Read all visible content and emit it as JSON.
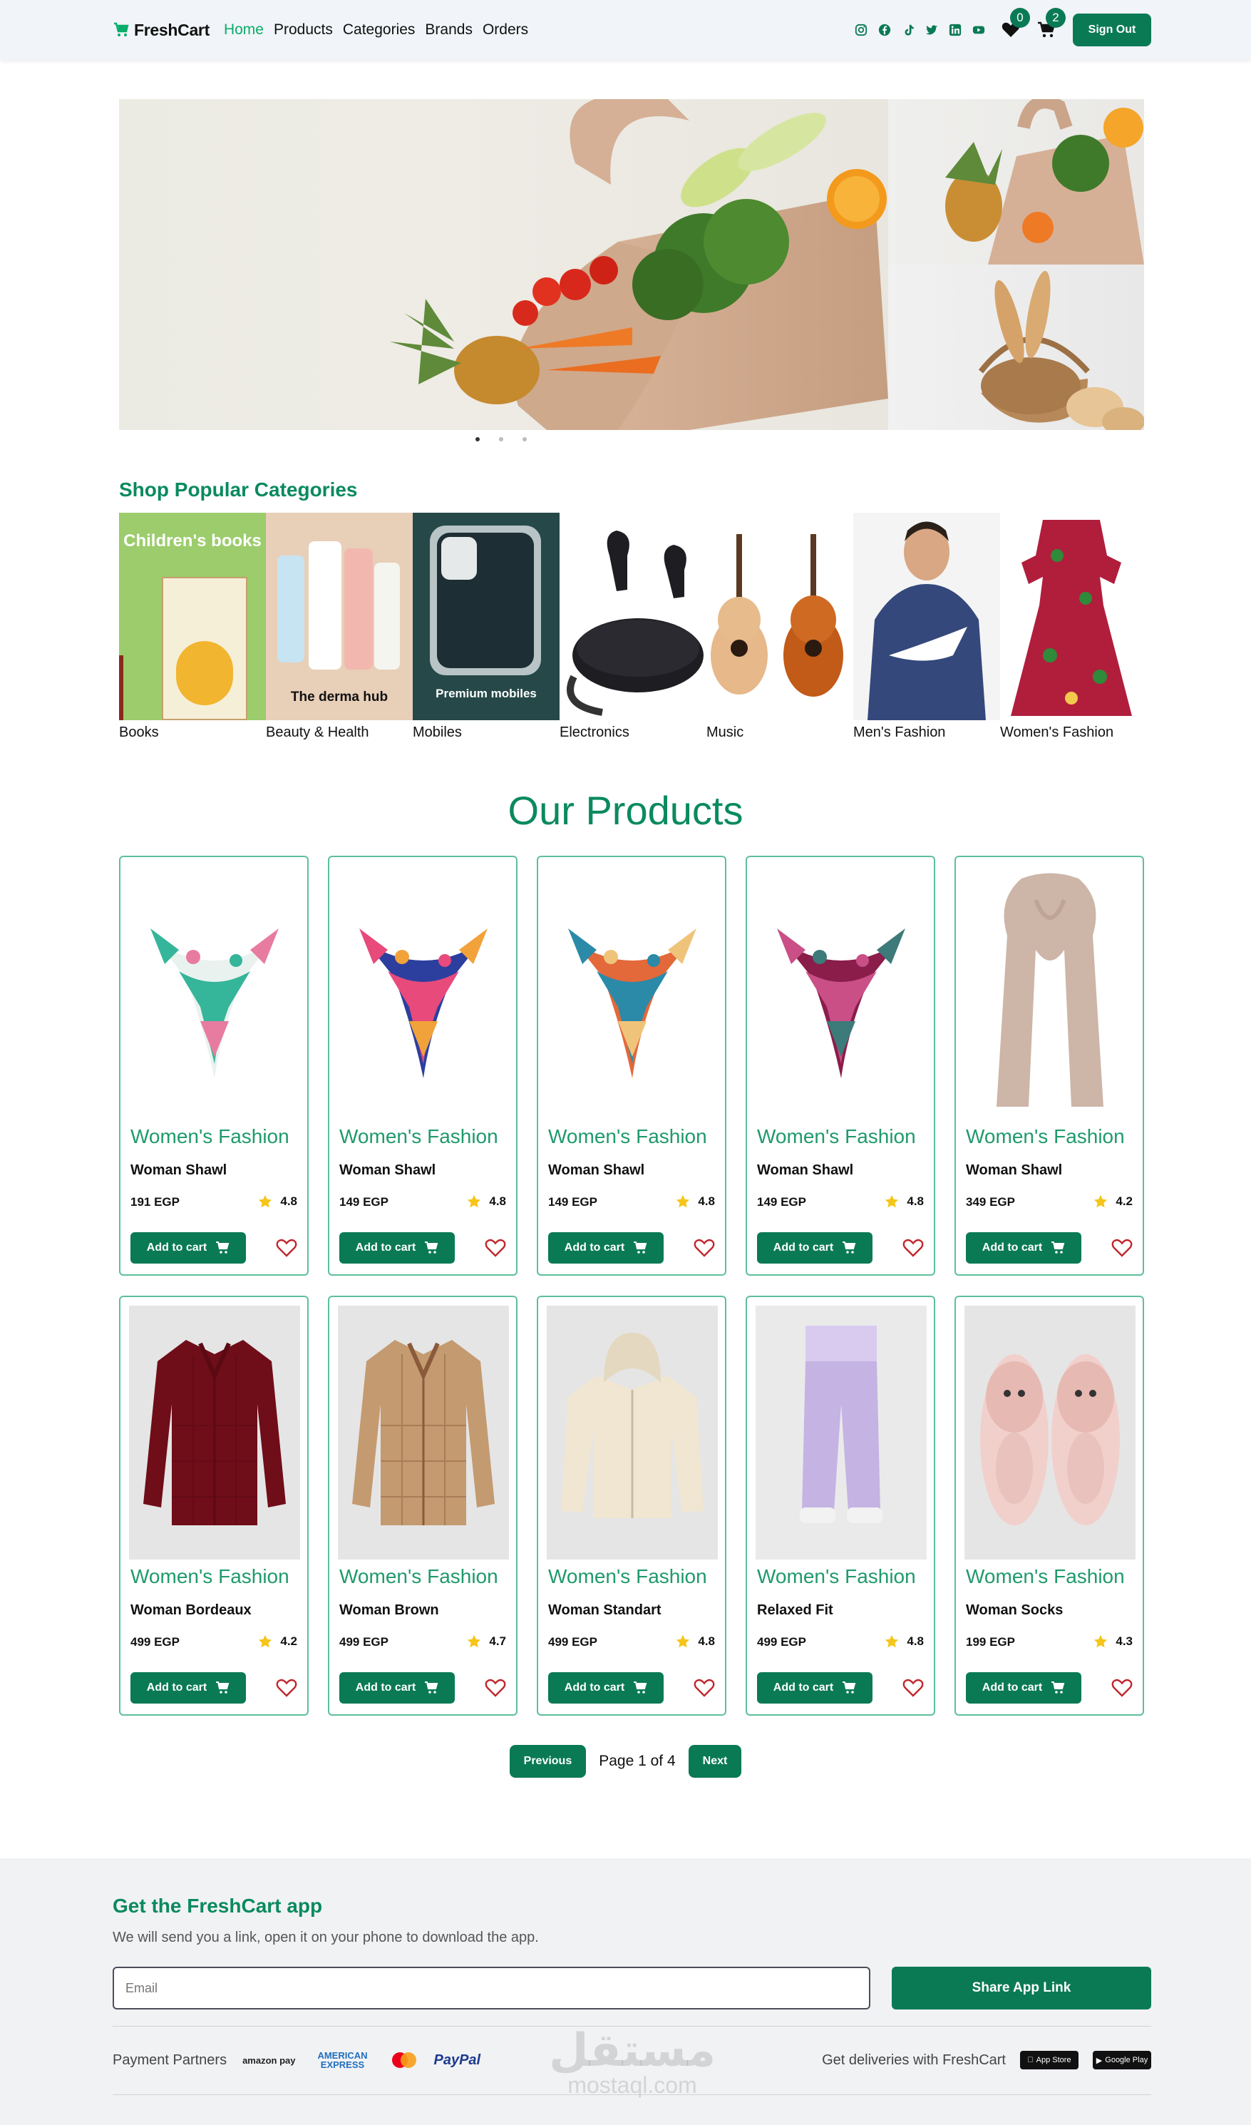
{
  "navbar": {
    "brand": "FreshCart",
    "links": [
      {
        "label": "Home",
        "active": true
      },
      {
        "label": "Products",
        "active": false
      },
      {
        "label": "Categories",
        "active": false
      },
      {
        "label": "Brands",
        "active": false
      },
      {
        "label": "Orders",
        "active": false
      }
    ],
    "socials": [
      "instagram-icon",
      "facebook-icon",
      "tiktok-icon",
      "twitter-icon",
      "linkedin-icon",
      "youtube-icon"
    ],
    "wishlist_count": "0",
    "cart_count": "2",
    "signout_label": "Sign Out"
  },
  "hero": {
    "slides": 3,
    "active_slide": 1
  },
  "categories": {
    "title": "Shop Popular Categories",
    "items": [
      {
        "label": "Books",
        "overlay": "Children's books"
      },
      {
        "label": "Beauty & Health",
        "overlay": "The derma hub"
      },
      {
        "label": "Mobiles",
        "overlay": "Premium mobiles"
      },
      {
        "label": "Electronics",
        "overlay": ""
      },
      {
        "label": "Music",
        "overlay": ""
      },
      {
        "label": "Men's Fashion",
        "overlay": ""
      },
      {
        "label": "Women's Fashion",
        "overlay": ""
      }
    ]
  },
  "products": {
    "title": "Our Products",
    "add_label": "Add to cart",
    "items": [
      {
        "category": "Women's Fashion",
        "name": "Woman Shawl",
        "price": "191 EGP",
        "rating": "4.8",
        "kind": "scarf",
        "colors": [
          "#e9f2ee",
          "#35b59a",
          "#e77ca0"
        ]
      },
      {
        "category": "Women's Fashion",
        "name": "Woman Shawl",
        "price": "149 EGP",
        "rating": "4.8",
        "kind": "scarf",
        "colors": [
          "#2c3f9e",
          "#e74a7b",
          "#f2a23a"
        ]
      },
      {
        "category": "Women's Fashion",
        "name": "Woman Shawl",
        "price": "149 EGP",
        "rating": "4.8",
        "kind": "scarf",
        "colors": [
          "#e3683a",
          "#2a8aa8",
          "#f0c37a"
        ]
      },
      {
        "category": "Women's Fashion",
        "name": "Woman Shawl",
        "price": "149 EGP",
        "rating": "4.8",
        "kind": "scarf",
        "colors": [
          "#8a1d4a",
          "#c94f86",
          "#3d7a7a"
        ]
      },
      {
        "category": "Women's Fashion",
        "name": "Woman Shawl",
        "price": "349 EGP",
        "rating": "4.2",
        "kind": "longscarf",
        "colors": [
          "#cdb5a8",
          "#bfa396",
          "#d9c3b8"
        ]
      },
      {
        "category": "Women's Fashion",
        "name": "Woman Bordeaux",
        "price": "499 EGP",
        "rating": "4.2",
        "kind": "shirt",
        "colors": [
          "#6f0d18",
          "#5a0a13",
          "#7d1420"
        ]
      },
      {
        "category": "Women's Fashion",
        "name": "Woman Brown",
        "price": "499 EGP",
        "rating": "4.7",
        "kind": "shirt",
        "colors": [
          "#c49a70",
          "#8a5a3a",
          "#d8b08a"
        ]
      },
      {
        "category": "Women's Fashion",
        "name": "Woman Standart",
        "price": "499 EGP",
        "rating": "4.8",
        "kind": "hoodie",
        "colors": [
          "#f0e6d2",
          "#e4d8c0",
          "#f6eedd"
        ]
      },
      {
        "category": "Women's Fashion",
        "name": "Relaxed Fit",
        "price": "499 EGP",
        "rating": "4.8",
        "kind": "pants",
        "colors": [
          "#c5b3e3",
          "#b19fd4",
          "#d8cbef"
        ]
      },
      {
        "category": "Women's Fashion",
        "name": "Woman Socks",
        "price": "199 EGP",
        "rating": "4.3",
        "kind": "slippers",
        "colors": [
          "#f1d0cc",
          "#e7b9b3",
          "#ffffff"
        ]
      }
    ]
  },
  "pagination": {
    "previous": "Previous",
    "info": "Page 1 of 4",
    "next": "Next"
  },
  "footer": {
    "title": "Get the FreshCart app",
    "subtitle": "We will send you a link, open it on your phone to download the app.",
    "email_placeholder": "Email",
    "share_label": "Share App Link",
    "partners_label": "Payment Partners",
    "partners": [
      "amazon pay",
      "AMERICAN EXPRESS",
      "mastercard",
      "PayPal"
    ],
    "deliveries_label": "Get deliveries with FreshCart",
    "stores": [
      "App Store",
      "Google Play"
    ],
    "watermark": "مستقل",
    "watermark_sub": "mostaql.com"
  },
  "colors": {
    "primary": "#0a7a55",
    "accent": "#0a8a5e",
    "link_active": "#0aad6a",
    "card_border": "#5fbf9a",
    "star": "#f5c518",
    "heart": "#c0262d"
  }
}
